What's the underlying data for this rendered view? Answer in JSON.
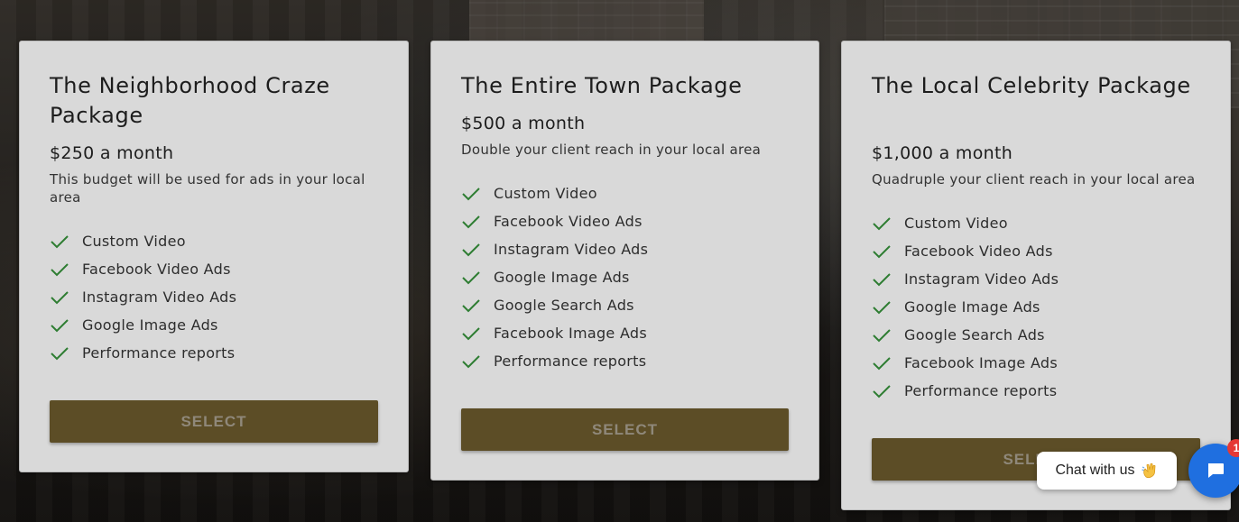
{
  "packages": [
    {
      "title": "The Neighborhood Craze Package",
      "price": "$250 a month",
      "description": "This budget will be used for ads in your local area",
      "features": [
        "Custom Video",
        "Facebook Video Ads",
        "Instagram Video Ads",
        "Google Image Ads",
        "Performance reports"
      ],
      "button_label": "SELECT"
    },
    {
      "title": "The Entire Town Package",
      "price": "$500 a month",
      "description": "Double your client reach in your local area",
      "features": [
        "Custom Video",
        "Facebook Video Ads",
        "Instagram Video Ads",
        "Google Image Ads",
        "Google Search Ads",
        "Facebook Image Ads",
        "Performance reports"
      ],
      "button_label": "SELECT"
    },
    {
      "title": "The Local Celebrity Package",
      "price": "$1,000 a month",
      "description": "Quadruple your client reach in your local area",
      "features": [
        "Custom Video",
        "Facebook Video Ads",
        "Instagram Video Ads",
        "Google Image Ads",
        "Google Search Ads",
        "Facebook Image Ads",
        "Performance reports"
      ],
      "button_label": "SELECT"
    }
  ],
  "chat": {
    "prompt": "Chat with us",
    "unread_count": "1",
    "launcher_icon": "chat-bubble-icon",
    "wave_icon": "waving-hand-icon"
  },
  "colors": {
    "card_bg": "#d9d9d9",
    "button_bg": "#5c4d26",
    "check": "#2e7d32",
    "chat_blue": "#1f6fe0",
    "badge": "#e53935"
  }
}
